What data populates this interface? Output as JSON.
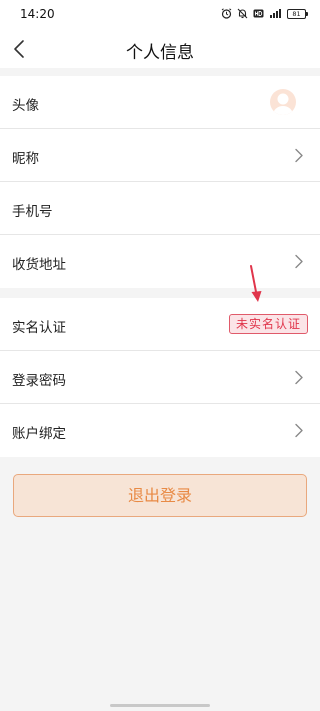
{
  "status_bar": {
    "time": "14:20",
    "battery": "81",
    "icons": [
      "alarm-icon",
      "mute-bell-icon",
      "hd-icon",
      "signal-icon",
      "battery-icon"
    ]
  },
  "header": {
    "title": "个人信息",
    "back_icon": "chevron-left-icon"
  },
  "group1": [
    {
      "label": "头像",
      "trailing": "avatar"
    },
    {
      "label": "昵称",
      "trailing": "chevron"
    },
    {
      "label": "手机号",
      "trailing": "none"
    },
    {
      "label": "收货地址",
      "trailing": "chevron"
    }
  ],
  "group2": [
    {
      "label": "实名认证",
      "trailing": "badge",
      "badge": "未实名认证"
    },
    {
      "label": "登录密码",
      "trailing": "chevron"
    },
    {
      "label": "账户绑定",
      "trailing": "chevron"
    }
  ],
  "logout": {
    "label": "退出登录"
  },
  "colors": {
    "accent": "#e88a45",
    "logout_bg": "#f7e4d6",
    "badge_text": "#e0354b",
    "badge_bg": "#fbe4e7",
    "annotation_arrow": "#e0354b",
    "page_bg": "#f4f4f4"
  }
}
